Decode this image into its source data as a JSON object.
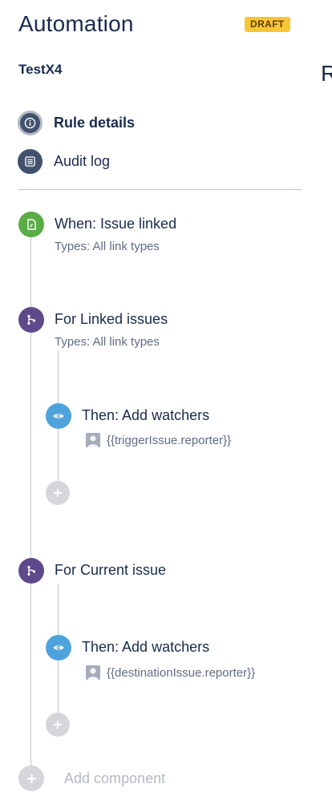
{
  "header": {
    "title": "Automation",
    "status_badge": "DRAFT",
    "rule_name": "TestX4",
    "right_panel_cut_text": "R"
  },
  "nav": {
    "items": [
      {
        "label": "Rule details",
        "icon": "info-icon",
        "selected": true
      },
      {
        "label": "Audit log",
        "icon": "list-icon",
        "selected": false
      }
    ]
  },
  "rule": {
    "trigger": {
      "title": "When: Issue linked",
      "subtitle": "Types: All link types",
      "icon": "trigger-icon",
      "color": "#5aac44"
    },
    "branches": [
      {
        "title": "For Linked issues",
        "subtitle": "Types: All link types",
        "icon": "branch-icon",
        "color": "#5e4a8a",
        "action": {
          "title": "Then: Add watchers",
          "value": "{{triggerIssue.reporter}}",
          "icon": "eye-icon",
          "color": "#4fa3dc"
        }
      },
      {
        "title": "For Current issue",
        "subtitle": "",
        "icon": "branch-icon",
        "color": "#5e4a8a",
        "action": {
          "title": "Then: Add watchers",
          "value": "{{destinationIssue.reporter}}",
          "icon": "eye-icon",
          "color": "#4fa3dc"
        }
      }
    ],
    "add_component_label": "Add component"
  },
  "colors": {
    "badge": "#f8c537",
    "nav_icon": "#42526e",
    "line": "#c1c7d0"
  }
}
